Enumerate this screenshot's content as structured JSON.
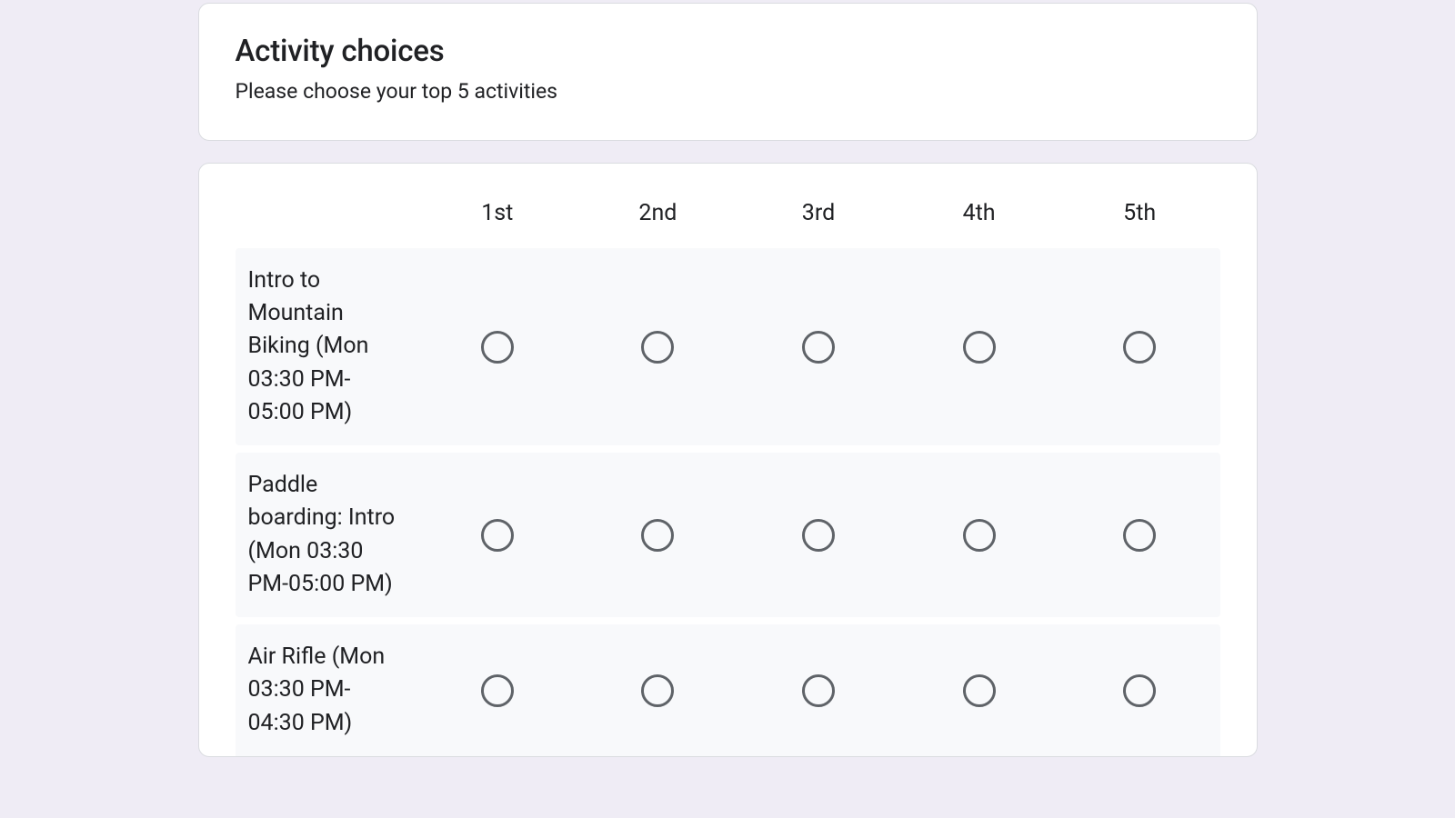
{
  "section": {
    "title": "Activity choices",
    "description": "Please choose your top 5 activities"
  },
  "grid": {
    "columns": [
      "1st",
      "2nd",
      "3rd",
      "4th",
      "5th"
    ],
    "rows": [
      {
        "label": "Intro to Mountain Biking (Mon 03:30 PM-05:00 PM)"
      },
      {
        "label": "Paddle boarding: Intro (Mon 03:30 PM-05:00 PM)"
      },
      {
        "label": "Air Rifle (Mon 03:30 PM-04:30 PM)"
      }
    ]
  }
}
